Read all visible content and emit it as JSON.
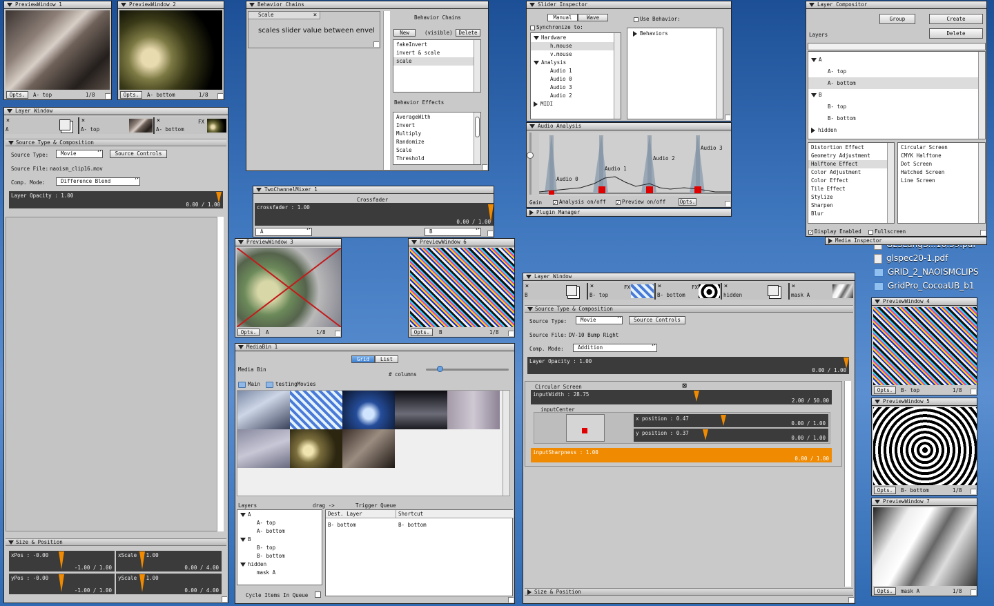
{
  "pw1": {
    "title": "PreviewWindow 1",
    "opts": "Opts.",
    "layer": "A- top",
    "frac": "1/8"
  },
  "pw2": {
    "title": "PreviewWindow 2",
    "opts": "Opts.",
    "layer": "A- bottom",
    "frac": "1/8"
  },
  "pw3": {
    "title": "PreviewWindow 3",
    "opts": "Opts.",
    "layer": "A",
    "frac": "1/8"
  },
  "pw6": {
    "title": "PreviewWindow 6",
    "opts": "Opts.",
    "layer": "B",
    "frac": "1/8"
  },
  "pw4": {
    "title": "PreviewWindow 4",
    "opts": "Opts.",
    "layer": "B- top",
    "frac": "1/8"
  },
  "pw5": {
    "title": "PreviewWindow 5",
    "opts": "Opts.",
    "layer": "B- bottom",
    "frac": "1/8"
  },
  "pw7": {
    "title": "PreviewWindow 7",
    "opts": "Opts.",
    "layer": "mask A",
    "frac": "1/8"
  },
  "lw1": {
    "title": "Layer Window",
    "tabs": [
      {
        "label": "A"
      },
      {
        "label": "A- top"
      },
      {
        "label": "A- bottom",
        "fx": "FX"
      }
    ],
    "section_source": "Source Type & Composition",
    "source_type_label": "Source Type:",
    "source_type_value": "Movie",
    "source_controls": "Source Controls",
    "source_file_label": "Source File:",
    "source_file_value": "naoism_clip16.mov",
    "comp_mode_label": "Comp. Mode:",
    "comp_mode_value": "Difference Blend",
    "opacity_label": "Layer Opacity : 1.00",
    "opacity_range": "0.00 / 1.00",
    "opacity_value": 1.0,
    "section_size": "Size & Position",
    "xpos_label": "xPos : -0.00",
    "xpos_range": "-1.00 / 1.00",
    "xscale_label": "xScale : 1.00",
    "xscale_range": "0.00 / 4.00",
    "ypos_label": "yPos : -0.00",
    "ypos_range": "-1.00 / 1.00",
    "yscale_label": "yScale : 1.00",
    "yscale_range": "0.00 / 4.00"
  },
  "bc": {
    "title": "Behavior Chains",
    "tip_title": "Scale",
    "tip_text": "scales slider value between envel",
    "header": "Behavior Chains",
    "new": "New",
    "visible": "(visible)",
    "delete": "Delete",
    "chains": [
      "fakeInvert",
      "invert & scale",
      "scale"
    ],
    "effects_header": "Behavior Effects",
    "effects": [
      "AverageWith",
      "Invert",
      "Multiply",
      "Randomize",
      "Scale",
      "Threshold"
    ]
  },
  "mixer": {
    "title": "TwoChannelMixer 1",
    "header": "Crossfader",
    "slider_label": "crossfader : 1.00",
    "range": "0.00 / 1.00",
    "a": "A",
    "b": "B"
  },
  "si": {
    "title": "Slider Inspector",
    "tab_manual": "Manual",
    "tab_wave": "Wave",
    "use_behavior": "Use Behavior:",
    "sync": "Synchronize to:",
    "behaviors": "Behaviors",
    "tree": [
      {
        "label": "Hardware",
        "level": 0,
        "open": true
      },
      {
        "label": "h.mouse",
        "level": 2,
        "sel": true
      },
      {
        "label": "v.mouse",
        "level": 2
      },
      {
        "label": "Analysis",
        "level": 0,
        "open": true
      },
      {
        "label": "Audio 1",
        "level": 2
      },
      {
        "label": "Audio 0",
        "level": 2
      },
      {
        "label": "Audio 3",
        "level": 2
      },
      {
        "label": "Audio 2",
        "level": 2
      },
      {
        "label": "MIDI",
        "level": 0,
        "open": false
      }
    ]
  },
  "aa": {
    "title": "Audio Analysis",
    "gain": "Gain",
    "analysis": "Analysis on/off",
    "preview": "Preview on/off",
    "opts": "Opts.",
    "labels": [
      "Audio 0",
      "Audio 1",
      "Audio 2",
      "Audio 3"
    ],
    "plugin": "Plugin Manager"
  },
  "lc": {
    "title": "Layer Compositor",
    "group": "Group",
    "create": "Create",
    "delete": "Delete",
    "layers": "Layers",
    "tree": [
      {
        "label": "A",
        "level": 0,
        "open": true
      },
      {
        "label": "A- top",
        "level": 2
      },
      {
        "label": "A- bottom",
        "level": 2,
        "sel": true
      },
      {
        "label": "B",
        "level": 0,
        "open": true
      },
      {
        "label": "B- top",
        "level": 2
      },
      {
        "label": "B- bottom",
        "level": 2
      },
      {
        "label": "hidden",
        "level": 0,
        "open": false
      }
    ],
    "effects_left": [
      "Distortion Effect",
      "Geometry Adjustment",
      "Halftone Effect",
      "Color Adjustment",
      "Color Effect",
      "Tile Effect",
      "Stylize",
      "Sharpen",
      "Blur"
    ],
    "effects_right": [
      "Circular Screen",
      "CMYK Halftone",
      "Dot Screen",
      "Hatched Screen",
      "Line Screen"
    ],
    "display_enabled": "Display Enabled",
    "fullscreen": "Fullscreen",
    "media_inspector": "Media Inspector"
  },
  "desktop": [
    "GLSLangS...16.39.pdf",
    "glspec20-1.pdf",
    "GRID_2_NAOISMCLIPS",
    "GridPro_CocoaUB_b1"
  ],
  "mb": {
    "title": "MediaBin 1",
    "tab_grid": "Grid",
    "tab_list": "List",
    "media_bin": "Media Bin",
    "columns": "# columns",
    "folder_main": "Main",
    "folder_movies": "testingMovies",
    "layers": "Layers",
    "drag": "drag ->",
    "trigger_queue": "Trigger Queue",
    "tree": [
      {
        "label": "A",
        "level": 0,
        "open": true
      },
      {
        "label": "A- top",
        "level": 2
      },
      {
        "label": "A- bottom",
        "level": 2
      },
      {
        "label": "B",
        "level": 0,
        "open": true
      },
      {
        "label": "B- top",
        "level": 2
      },
      {
        "label": "B- bottom",
        "level": 2
      },
      {
        "label": "hidden",
        "level": 0,
        "open": true
      },
      {
        "label": "mask A",
        "level": 2
      }
    ],
    "col_dest": "Dest. Layer",
    "col_shortcut": "Shortcut",
    "queue_dest": "B- bottom",
    "queue_shortcut": "B- bottom",
    "cycle": "Cycle Items In Queue"
  },
  "lw2": {
    "title": "Layer Window",
    "tabs": [
      {
        "label": "B"
      },
      {
        "label": "B- top",
        "fx": "FX"
      },
      {
        "label": "B- bottom",
        "fx": "FX"
      },
      {
        "label": "hidden"
      },
      {
        "label": "mask A"
      }
    ],
    "section_source": "Source Type & Composition",
    "source_type_label": "Source Type:",
    "source_type_value": "Movie",
    "source_controls": "Source Controls",
    "source_file_label": "Source File:",
    "source_file_value": "DV-10 Bump Right",
    "comp_mode_label": "Comp. Mode:",
    "comp_mode_value": "Addition",
    "opacity_label": "Layer Opacity : 1.00",
    "opacity_range": "0.00 / 1.00",
    "effect_title": "Circular Screen",
    "input_width": "inputWidth : 28.75",
    "input_width_range": "2.00 / 50.00",
    "input_center": "inputCenter",
    "xpos": "x position : 0.47",
    "xpos_range": "0.00 / 1.00",
    "ypos": "y position : 0.37",
    "ypos_range": "0.00 / 1.00",
    "sharp": "inputSharpness : 1.00",
    "sharp_range": "0.00 / 1.00",
    "section_size": "Size & Position"
  }
}
